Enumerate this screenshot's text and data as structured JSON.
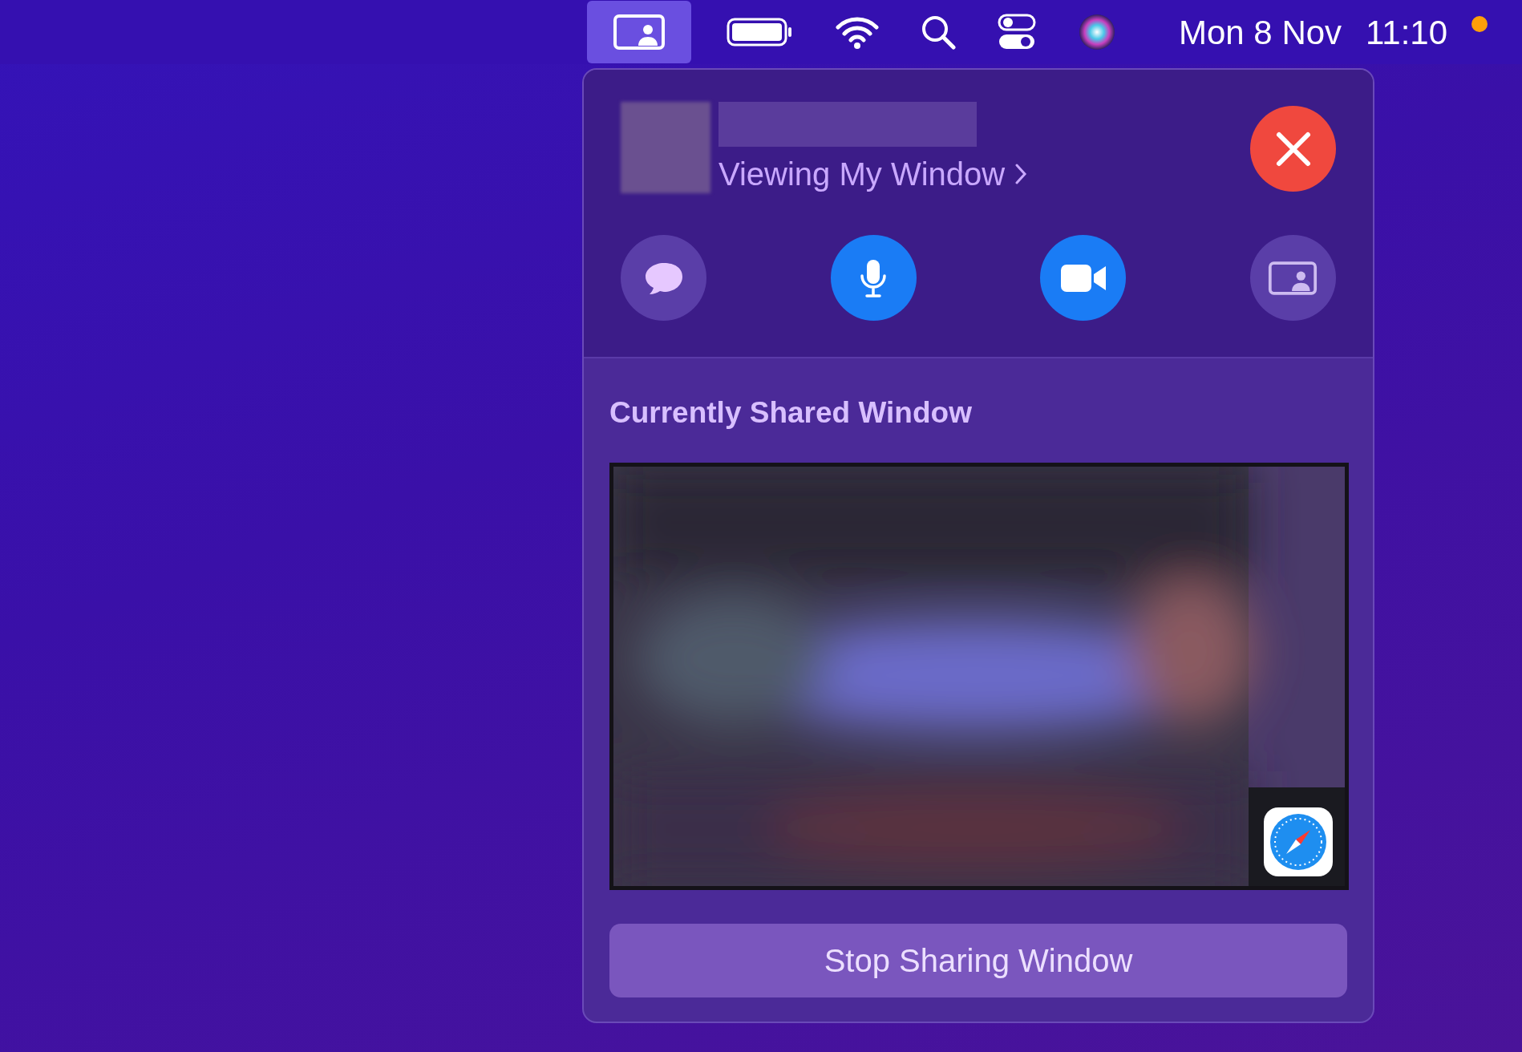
{
  "menu_bar": {
    "items": [
      {
        "kind": "screen-share",
        "selected": true
      },
      {
        "kind": "battery",
        "selected": false
      },
      {
        "kind": "wifi",
        "selected": false
      },
      {
        "kind": "search",
        "selected": false
      },
      {
        "kind": "control-center",
        "selected": false
      },
      {
        "kind": "siri",
        "selected": false
      }
    ],
    "date": "Mon 8 Nov",
    "time": "11:10",
    "recording_dot": {
      "color": "#ff9f0a"
    }
  },
  "panel": {
    "status": "Viewing My Window",
    "controls": [
      {
        "kind": "messages",
        "on": false
      },
      {
        "kind": "microphone",
        "on": true
      },
      {
        "kind": "camera",
        "on": true
      },
      {
        "kind": "screen-share",
        "on": false
      }
    ],
    "section_title": "Currently Shared Window",
    "stop_button": "Stop Sharing Window"
  }
}
